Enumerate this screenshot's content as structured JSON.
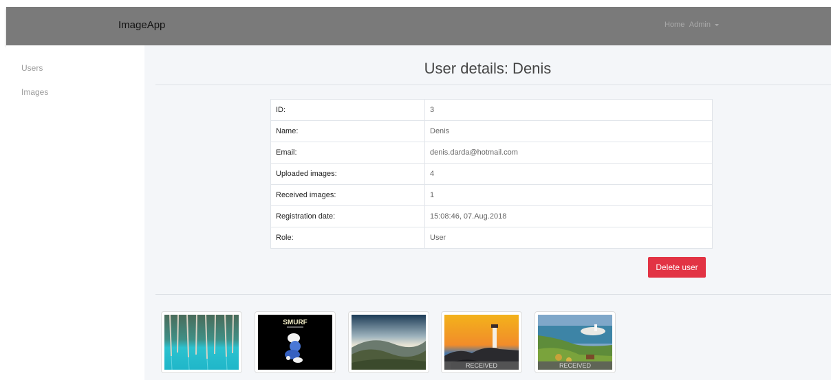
{
  "navbar": {
    "brand": "ImageApp",
    "links": {
      "home": "Home",
      "admin": "Admin"
    }
  },
  "sidebar": {
    "items": [
      {
        "label": "Users"
      },
      {
        "label": "Images"
      }
    ]
  },
  "main": {
    "title": "User details: Denis",
    "details": [
      {
        "label": "ID:",
        "value": "3"
      },
      {
        "label": "Name:",
        "value": "Denis"
      },
      {
        "label": "Email:",
        "value": "denis.darda@hotmail.com"
      },
      {
        "label": "Uploaded images:",
        "value": "4"
      },
      {
        "label": "Received images:",
        "value": "1"
      },
      {
        "label": "Registration date:",
        "value": "15:08:46, 07.Aug.2018"
      },
      {
        "label": "Role:",
        "value": "User"
      }
    ],
    "delete_label": "Delete user",
    "images": [
      {
        "subject": "turquoise-forest-lake",
        "badge": ""
      },
      {
        "subject": "smurf-challenge-logo",
        "badge": "",
        "logo_text": "SMURF"
      },
      {
        "subject": "misty-hills",
        "badge": ""
      },
      {
        "subject": "lighthouse-sunset",
        "badge": "RECEIVED"
      },
      {
        "subject": "coastal-lighthouse-island",
        "badge": "RECEIVED"
      }
    ]
  },
  "colors": {
    "navbar": "#7a7a7a",
    "background": "#f4f6f9",
    "danger": "#e23344"
  }
}
